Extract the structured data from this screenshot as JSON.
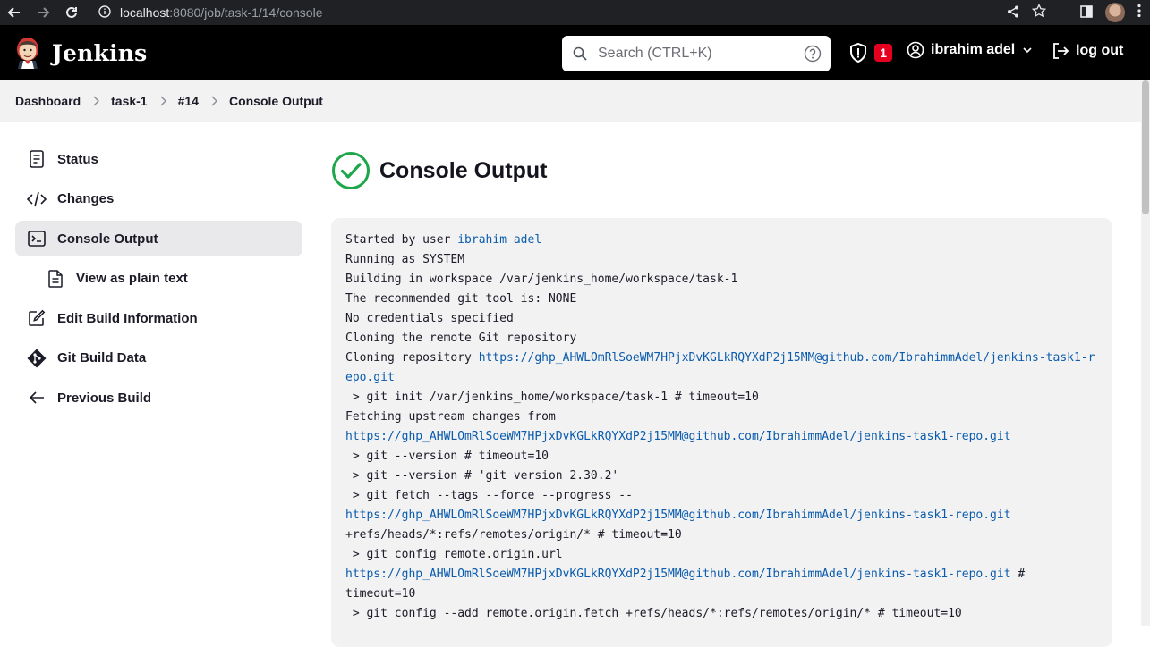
{
  "browser": {
    "url_host": "localhost",
    "url_path": ":8080/job/task-1/14/console"
  },
  "header": {
    "brand": "Jenkins",
    "search_placeholder": "Search (CTRL+K)",
    "security_count": "1",
    "user_name": "ibrahim adel",
    "logout_label": "log out"
  },
  "breadcrumb": [
    "Dashboard",
    "task-1",
    "#14",
    "Console Output"
  ],
  "sidebar": {
    "items": [
      {
        "label": "Status"
      },
      {
        "label": "Changes"
      },
      {
        "label": "Console Output"
      },
      {
        "label": "View as plain text"
      },
      {
        "label": "Edit Build Information"
      },
      {
        "label": "Git Build Data"
      },
      {
        "label": "Previous Build"
      }
    ]
  },
  "main": {
    "title": "Console Output"
  },
  "console": {
    "started_prefix": "Started by user ",
    "started_user": "ibrahim adel",
    "l2": "Running as SYSTEM",
    "l3": "Building in workspace /var/jenkins_home/workspace/task-1",
    "l4": "The recommended git tool is: NONE",
    "l5": "No credentials specified",
    "l6": "Cloning the remote Git repository",
    "l7_prefix": "Cloning repository ",
    "repo_url_1": "https://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@github.com/IbrahimmAdel/jenkins-task1-repo.git",
    "l8": " > git init /var/jenkins_home/workspace/task-1 # timeout=10",
    "l9": "Fetching upstream changes from",
    "repo_url_2": "https://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@github.com/IbrahimmAdel/jenkins-task1-repo.git",
    "l10": " > git --version # timeout=10",
    "l11": " > git --version # 'git version 2.30.2'",
    "l12": " > git fetch --tags --force --progress --",
    "repo_url_3": "https://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@github.com/IbrahimmAdel/jenkins-task1-repo.git",
    "l13": "+refs/heads/*:refs/remotes/origin/* # timeout=10",
    "l14": " > git config remote.origin.url",
    "repo_url_4": "https://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@github.com/IbrahimmAdel/jenkins-task1-repo.git",
    "l15_suffix": " #\ntimeout=10",
    "l16": " > git config --add remote.origin.fetch +refs/heads/*:refs/remotes/origin/* # timeout=10"
  },
  "colors": {
    "success": "#1ea64b",
    "link": "#0b5cad",
    "badge": "#e6001f"
  },
  "icons": [
    "back-arrow-icon",
    "forward-arrow-icon",
    "reload-icon",
    "info-icon",
    "share-icon",
    "star-icon",
    "sidepanel-icon",
    "more-vert-icon",
    "jenkins-logo",
    "search-icon",
    "help-icon",
    "shield-icon",
    "user-icon",
    "chevron-down-icon",
    "logout-icon",
    "document-icon",
    "code-icon",
    "terminal-icon",
    "file-icon",
    "edit-icon",
    "git-icon",
    "arrow-left-icon",
    "check-circle-icon"
  ]
}
